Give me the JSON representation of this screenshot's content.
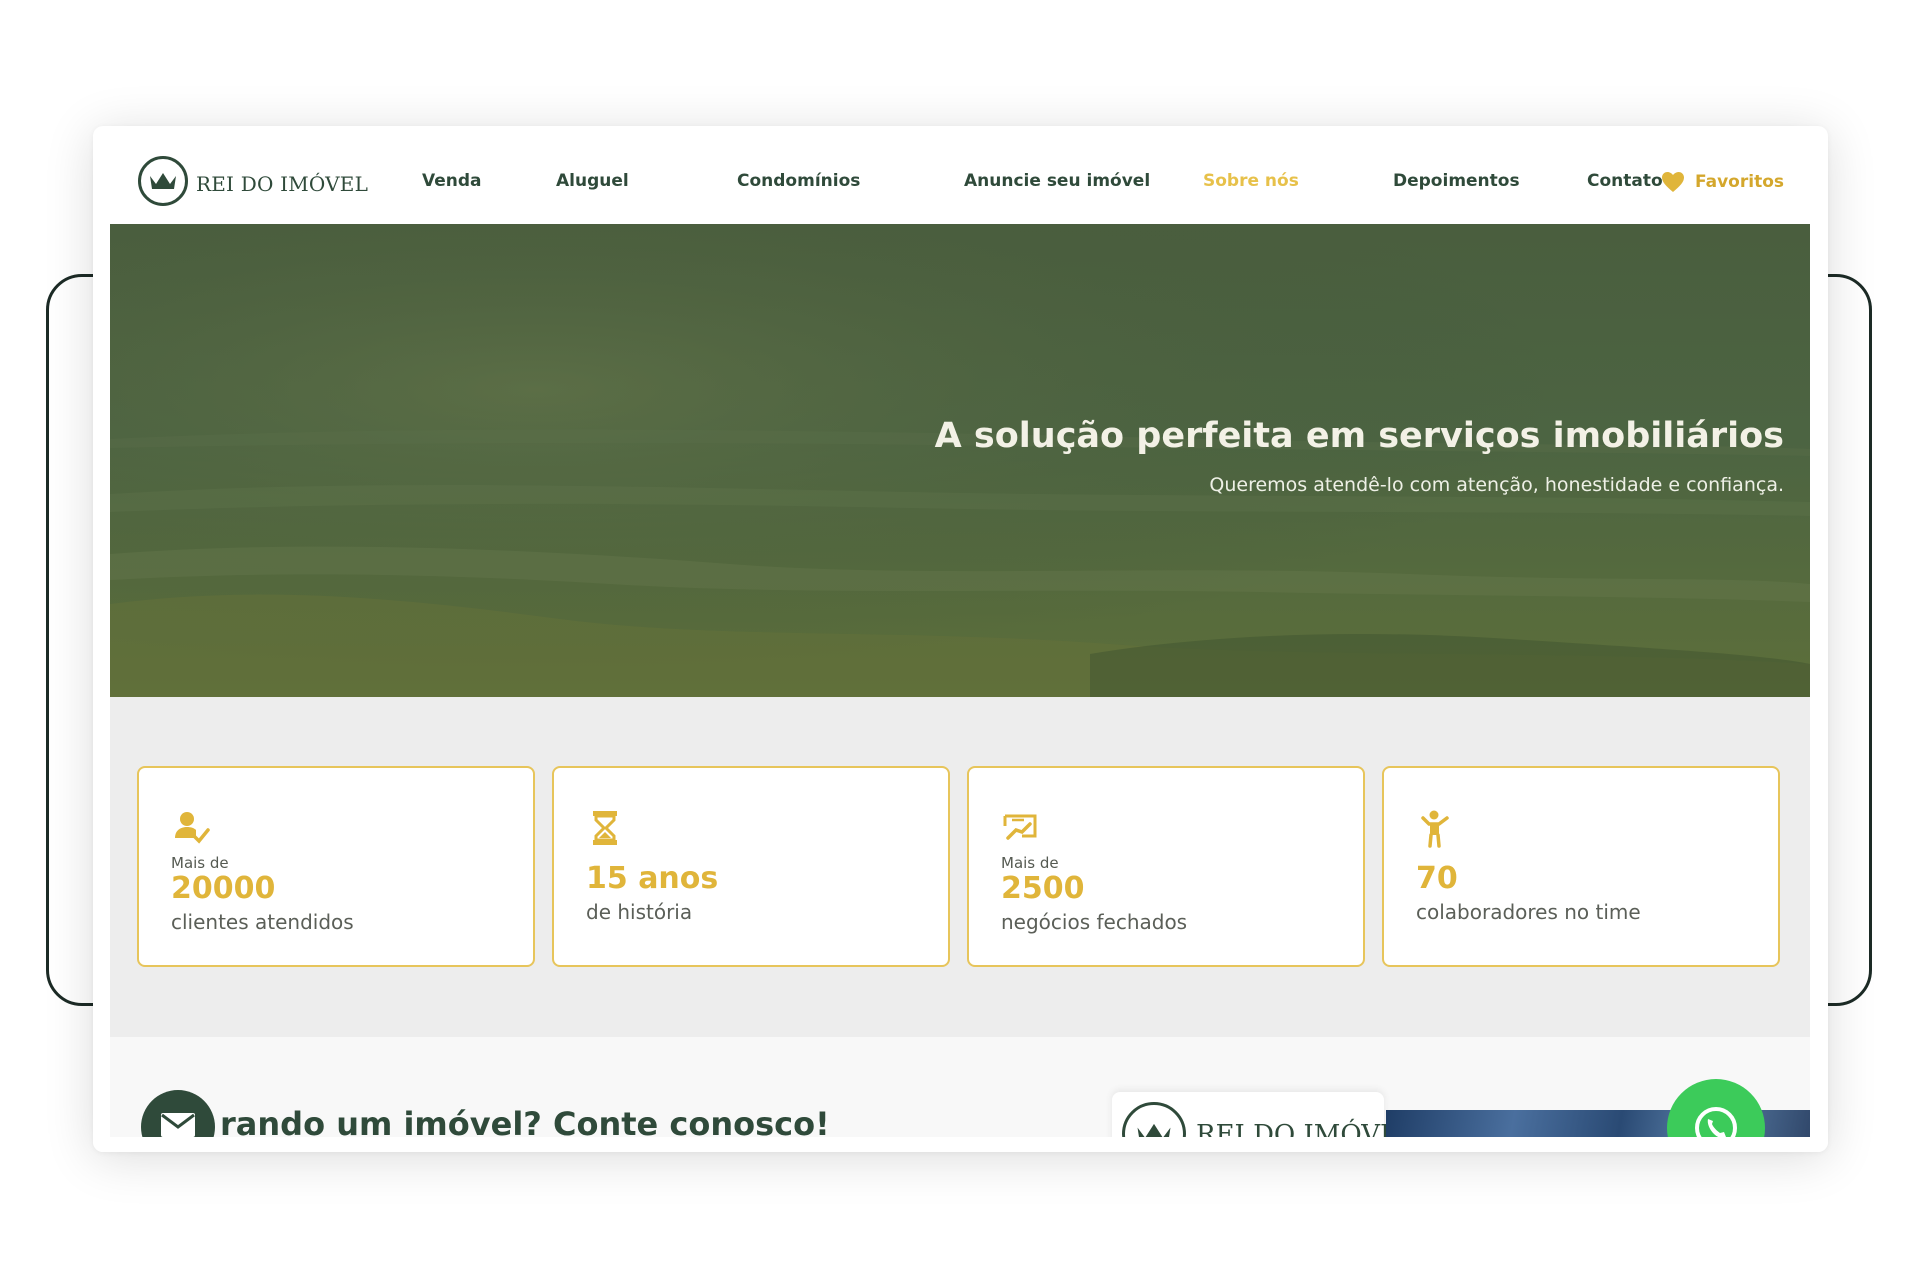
{
  "logo": {
    "text": "REI DO IMÓVEL"
  },
  "nav": {
    "items": [
      {
        "label": "Venda"
      },
      {
        "label": "Aluguel"
      },
      {
        "label": "Condomínios"
      },
      {
        "label": "Anuncie seu imóvel"
      },
      {
        "label": "Sobre nós",
        "active": true
      },
      {
        "label": "Depoimentos"
      },
      {
        "label": "Contato"
      }
    ],
    "favorites_label": "Favoritos",
    "favorites_icon": "heart-icon"
  },
  "hero": {
    "title": "A solução perfeita em serviços imobiliários",
    "subtitle": "Queremos atendê-lo com atenção, honestidade e confiança."
  },
  "stats": [
    {
      "icon": "user-check-icon",
      "prefix": "Mais de",
      "value": "20000",
      "description": "clientes atendidos"
    },
    {
      "icon": "hourglass-icon",
      "prefix": "",
      "value": "15 anos",
      "description": "de história"
    },
    {
      "icon": "handshake-deal-icon",
      "prefix": "Mais de",
      "value": "2500",
      "description": "negócios fechados"
    },
    {
      "icon": "person-raising-hand-icon",
      "prefix": "",
      "value": "70",
      "description": "colaboradores no time"
    }
  ],
  "bottom": {
    "heading_partial": "rando um imóvel? Conte conosco!",
    "logo_text": "REI DO IMÓVEL",
    "mail_icon": "envelope-icon",
    "whatsapp_icon": "whatsapp-icon"
  },
  "colors": {
    "brand_green": "#2f4a3a",
    "brand_gold": "#e0b53a",
    "card_border": "#e7c55b",
    "whatsapp_green": "#3ccb5a"
  }
}
